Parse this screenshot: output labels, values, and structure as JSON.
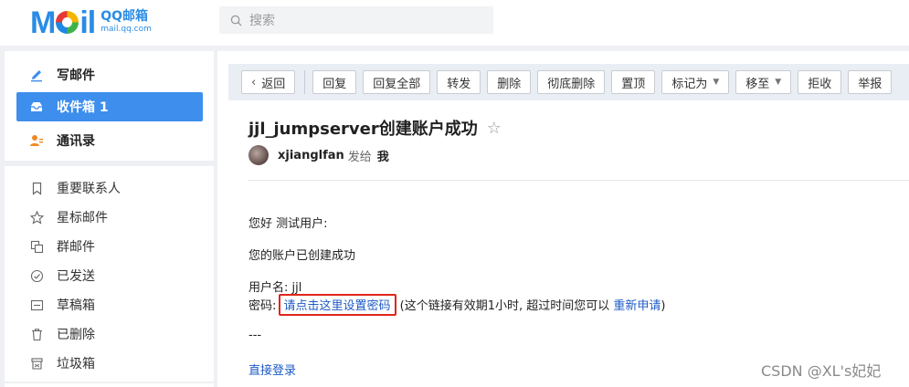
{
  "logo": {
    "word_a": "M",
    "word_b": "il",
    "cn": "QQ邮箱",
    "url": "mail.qq.com"
  },
  "search": {
    "placeholder": "搜索"
  },
  "nav": {
    "compose": "写邮件",
    "inbox": "收件箱 1",
    "contacts": "通讯录"
  },
  "folders": [
    "重要联系人",
    "星标邮件",
    "群邮件",
    "已发送",
    "草稿箱",
    "已删除",
    "垃圾箱"
  ],
  "toolbar": {
    "back": "返回",
    "reply": "回复",
    "reply_all": "回复全部",
    "forward": "转发",
    "delete": "删除",
    "delete_forever": "彻底删除",
    "pin": "置顶",
    "mark_as": "标记为",
    "move_to": "移至",
    "reject": "拒收",
    "report": "举报"
  },
  "email": {
    "subject": "jjl_jumpserver创建账户成功",
    "sender": "xjianglfan",
    "sent_to": "发给",
    "recipient": "我",
    "greeting": "您好 测试用户:",
    "created": "您的账户已创建成功",
    "username_label": "用户名: ",
    "username": "jjl",
    "password_label": "密码: ",
    "set_password_link": "请点击这里设置密码",
    "expiry_note": " (这个链接有效期1小时, 超过时间您可以 ",
    "reapply_link": "重新申请",
    "close_paren": ")",
    "dashes": "---",
    "direct_login": "直接登录"
  },
  "watermark": "CSDN @XL's妃妃",
  "colors": {
    "accent": "#3e8eed",
    "link": "#1d5bc4",
    "highlight_box": "#e0251b"
  }
}
